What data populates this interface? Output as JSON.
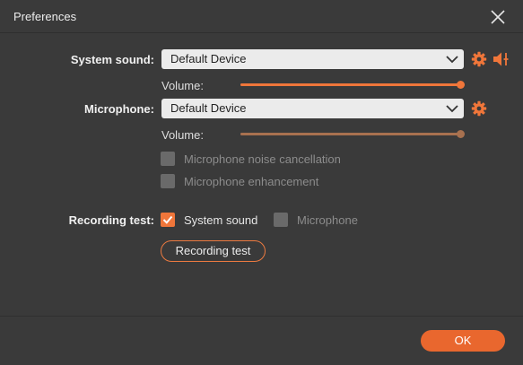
{
  "window": {
    "title": "Preferences"
  },
  "system_sound": {
    "label": "System sound:",
    "device": "Default Device",
    "volume_label": "Volume:",
    "volume": 1.0
  },
  "microphone": {
    "label": "Microphone:",
    "device": "Default Device",
    "volume_label": "Volume:",
    "volume": 1.0,
    "noise_cancellation": {
      "label": "Microphone noise cancellation",
      "checked": false,
      "enabled": false
    },
    "enhancement": {
      "label": "Microphone enhancement",
      "checked": false,
      "enabled": false
    }
  },
  "recording_test": {
    "label": "Recording test:",
    "system_sound": {
      "label": "System sound",
      "checked": true
    },
    "microphone": {
      "label": "Microphone",
      "checked": false
    },
    "button_label": "Recording test"
  },
  "footer": {
    "ok_label": "OK"
  },
  "colors": {
    "accent": "#f0763a",
    "ok_button": "#e9672e",
    "background": "#3a3a3a",
    "mic_slider": "#a8714f"
  },
  "icons": {
    "close": "close-icon",
    "dropdown": "chevron-down-icon",
    "settings": "gear-icon",
    "speaker": "speaker-volume-icon"
  }
}
